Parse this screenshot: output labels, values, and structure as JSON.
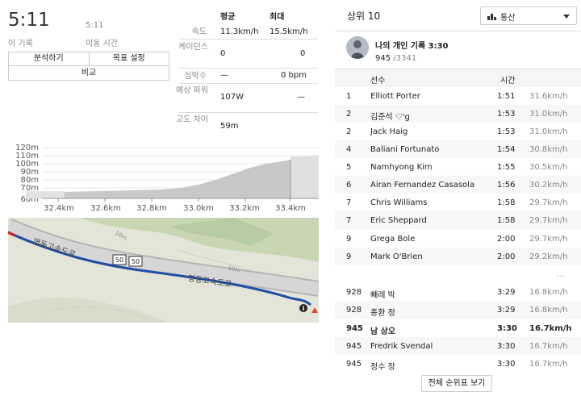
{
  "summary": {
    "elapsed_time": "5:11",
    "elapsed_label": "이 기록",
    "moving_time": "5:11",
    "moving_label": "이동 시간"
  },
  "actions": {
    "analyze": "분석하기",
    "goal": "목표 설정",
    "compare": "비교"
  },
  "stats": {
    "col_avg": "평균",
    "col_max": "최대",
    "rows": [
      {
        "label": "속도",
        "avg": "11.3km/h",
        "max": "15.5km/h"
      },
      {
        "label": "케이던스",
        "avg": "0",
        "max": "0"
      },
      {
        "label": "심박수",
        "avg": "—",
        "max": "0 bpm"
      },
      {
        "label": "예상 파워",
        "avg": "107W",
        "max": "—"
      },
      {
        "label": "고도 차이",
        "avg": "59m",
        "max": ""
      }
    ]
  },
  "elevation_chart": {
    "y_ticks": [
      "120m",
      "110m",
      "100m",
      "90m",
      "80m",
      "70m",
      "60m"
    ],
    "x_ticks": [
      "32.4km",
      "32.6km",
      "32.8km",
      "33.0km",
      "33.2km",
      "33.4km"
    ]
  },
  "map": {
    "road_label_1": "영동고속도로",
    "road_label_2": "영동고속도로",
    "shield_1": "50",
    "shield_2": "50",
    "contour_1": "10m",
    "contour_2": "10m",
    "info_icon": "info-icon"
  },
  "leaderboard": {
    "title": "상위 10",
    "filter": "통산",
    "pr_title": "나의 개인 기록 3:30",
    "pr_rank": "945",
    "pr_total": "/3341",
    "col_athlete": "선수",
    "col_time": "시간",
    "top": [
      {
        "rank": "1",
        "name": "Elliott Porter",
        "time": "1:51",
        "speed": "31.6km/h"
      },
      {
        "rank": "2",
        "name": "김준석 ♡'g",
        "time": "1:53",
        "speed": "31.0km/h"
      },
      {
        "rank": "2",
        "name": "Jack Haig",
        "time": "1:53",
        "speed": "31.0km/h"
      },
      {
        "rank": "4",
        "name": "Baliani Fortunato",
        "time": "1:54",
        "speed": "30.8km/h"
      },
      {
        "rank": "5",
        "name": "Namhyong Kim",
        "time": "1:55",
        "speed": "30.5km/h"
      },
      {
        "rank": "6",
        "name": "Airan Fernandez Casasola",
        "time": "1:56",
        "speed": "30.2km/h"
      },
      {
        "rank": "7",
        "name": "Chris Williams",
        "time": "1:58",
        "speed": "29.7km/h"
      },
      {
        "rank": "7",
        "name": "Eric Sheppard",
        "time": "1:58",
        "speed": "29.7km/h"
      },
      {
        "rank": "9",
        "name": "Grega Bole",
        "time": "2:00",
        "speed": "29.7km/h"
      },
      {
        "rank": "9",
        "name": "Mark O'Brien",
        "time": "2:00",
        "speed": "29.2km/h"
      }
    ],
    "ellipsis": "...",
    "nearby": [
      {
        "rank": "928",
        "name": "빼레 박",
        "time": "3:29",
        "speed": "16.8km/h"
      },
      {
        "rank": "928",
        "name": "종환 정",
        "time": "3:29",
        "speed": "16.8km/h"
      },
      {
        "rank": "945",
        "name": "남 상오",
        "time": "3:30",
        "speed": "16.7km/h"
      },
      {
        "rank": "945",
        "name": "Fredrik Svendal",
        "time": "3:30",
        "speed": "16.7km/h"
      },
      {
        "rank": "945",
        "name": "정수 장",
        "time": "3:30",
        "speed": "16.7km/h"
      }
    ],
    "full_button": "전체 순위표 보기"
  }
}
